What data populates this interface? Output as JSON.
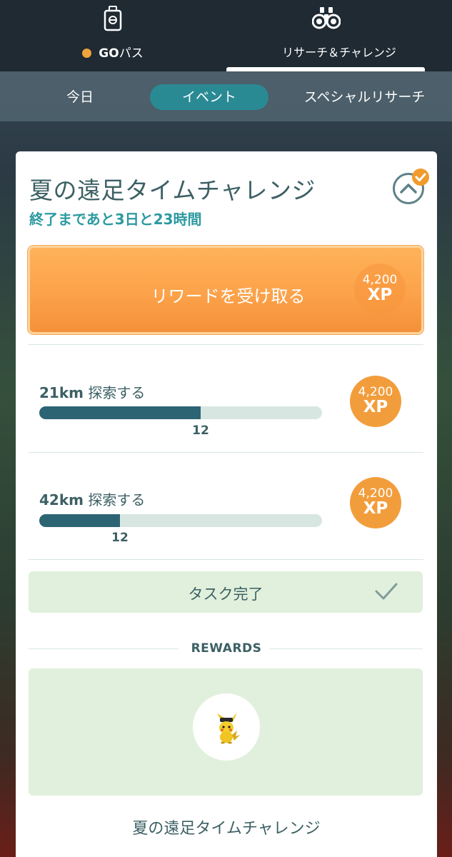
{
  "top_tabs": [
    {
      "label_bold": "GO",
      "label": "パス",
      "icon": "go-pass-icon",
      "active": false,
      "dot_color": "#f0a33b"
    },
    {
      "label": "リサーチ＆チャレンジ",
      "icon": "binoculars-icon",
      "active": true
    }
  ],
  "sub_tabs": [
    {
      "label": "今日",
      "active": false
    },
    {
      "label": "イベント",
      "active": true
    },
    {
      "label": "スペシャルリサーチ",
      "active": false
    }
  ],
  "card": {
    "title": "夏の遠足タイムチャレンジ",
    "time_left": "終了まであと3日と23時間",
    "claim": {
      "label": "リワードを受け取る",
      "xp_amount": "4,200",
      "xp_unit": "XP"
    },
    "tasks": [
      {
        "distance": "21km",
        "action": " 探索する",
        "progress_value": "12",
        "progress": 0.57,
        "xp_amount": "4,200",
        "xp_unit": "XP"
      },
      {
        "distance": "42km",
        "action": " 探索する",
        "progress_value": "12",
        "progress": 0.285,
        "xp_amount": "4,200",
        "xp_unit": "XP"
      }
    ],
    "complete_label": "タスク完了",
    "rewards_header": "REWARDS",
    "reward_item": "pikachu-icon",
    "footer_title": "夏の遠足タイムチャレンジ"
  },
  "colors": {
    "accent_orange": "#f29d3c",
    "teal": "#2a8a94",
    "progress_fill": "#2d6474",
    "complete_bg": "#e1f0dc"
  }
}
